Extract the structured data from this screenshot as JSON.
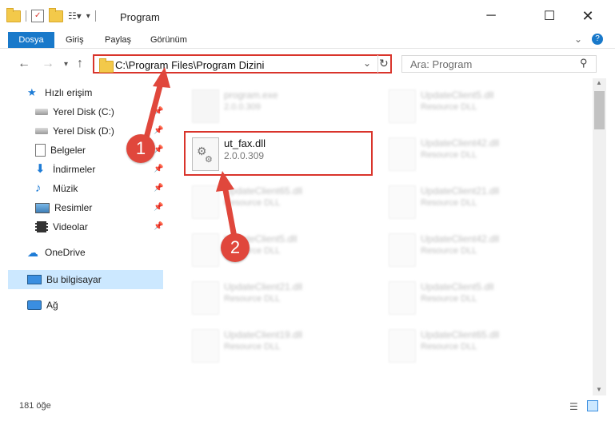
{
  "window": {
    "title": "Program"
  },
  "ribbon": {
    "tabs": [
      "Dosya",
      "Giriş",
      "Paylaş",
      "Görünüm"
    ]
  },
  "address": {
    "path": "C:\\Program Files\\Program Dizini"
  },
  "search": {
    "placeholder": "Ara: Program"
  },
  "sidebar": {
    "quick_access": "Hızlı erişim",
    "items": [
      "Yerel Disk (C:)",
      "Yerel Disk (D:)",
      "Belgeler",
      "İndirmeler",
      "Müzik",
      "Resimler",
      "Videolar"
    ],
    "onedrive": "OneDrive",
    "this_pc": "Bu bilgisayar",
    "network": "Ağ"
  },
  "files": [
    {
      "name": "program.exe",
      "sub": "2.0.0.309"
    },
    {
      "name": "UpdateClient5.dll",
      "sub": "Resource DLL"
    },
    {
      "name": "ut_fax.dll",
      "sub": "2.0.0.309"
    },
    {
      "name": "UpdateClient42.dll",
      "sub": "Resource DLL"
    },
    {
      "name": "UpdateClient65.dll",
      "sub": "Resource DLL"
    },
    {
      "name": "UpdateClient21.dll",
      "sub": "Resource DLL"
    },
    {
      "name": "UpdateClient5.dll",
      "sub": "Resource DLL"
    },
    {
      "name": "UpdateClient42.dll",
      "sub": "Resource DLL"
    },
    {
      "name": "UpdateClient21.dll",
      "sub": "Resource DLL"
    },
    {
      "name": "UpdateClient5.dll",
      "sub": "Resource DLL"
    },
    {
      "name": "UpdateClient19.dll",
      "sub": "Resource DLL"
    },
    {
      "name": "UpdateClient65.dll",
      "sub": "Resource DLL"
    }
  ],
  "status": {
    "count": "181 öğe"
  },
  "annotations": {
    "step1": "1",
    "step2": "2"
  },
  "colors": {
    "accent": "#1979ca",
    "highlight": "#d9342b",
    "selection": "#cce8ff"
  }
}
